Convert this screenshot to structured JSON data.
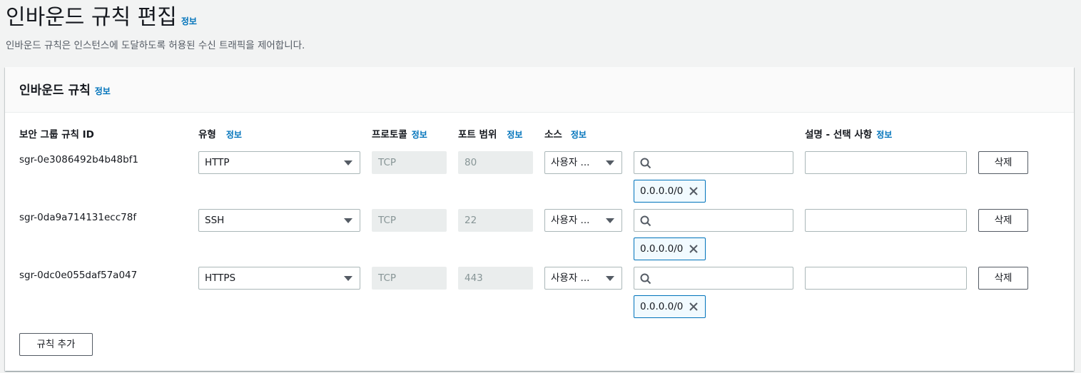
{
  "page": {
    "title": "인바운드 규칙 편집",
    "title_info": "정보",
    "description": "인바운드 규칙은 인스턴스에 도달하도록 허용된 수신 트래픽을 제어합니다."
  },
  "panel": {
    "title": "인바운드 규칙",
    "title_info": "정보",
    "columns": {
      "rule_id": "보안 그룹 규칙 ID",
      "type": "유형",
      "type_info": "정보",
      "protocol": "프로토콜",
      "protocol_info": "정보",
      "port_range": "포트 범위",
      "port_range_info": "정보",
      "source": "소스",
      "source_info": "정보",
      "description": "설명 - 선택 사항",
      "description_info": "정보"
    },
    "rules": [
      {
        "id": "sgr-0e3086492b4b48bf1",
        "type": "HTTP",
        "protocol": "TCP",
        "port": "80",
        "source_type": "사용자 ...",
        "search_value": "",
        "cidr": "0.0.0.0/0",
        "description": "",
        "delete_label": "삭제"
      },
      {
        "id": "sgr-0da9a714131ecc78f",
        "type": "SSH",
        "protocol": "TCP",
        "port": "22",
        "source_type": "사용자 ...",
        "search_value": "",
        "cidr": "0.0.0.0/0",
        "description": "",
        "delete_label": "삭제"
      },
      {
        "id": "sgr-0dc0e055daf57a047",
        "type": "HTTPS",
        "protocol": "TCP",
        "port": "443",
        "source_type": "사용자 ...",
        "search_value": "",
        "cidr": "0.0.0.0/0",
        "description": "",
        "delete_label": "삭제"
      }
    ],
    "add_rule_label": "규칙 추가"
  },
  "colors": {
    "link": "#0073bb",
    "background": "#f2f3f3",
    "token_bg": "#f1faff",
    "token_border": "#0073bb"
  },
  "icons": {
    "select_caret": "caret-down-icon",
    "search": "search-icon",
    "remove_token": "close-icon"
  }
}
